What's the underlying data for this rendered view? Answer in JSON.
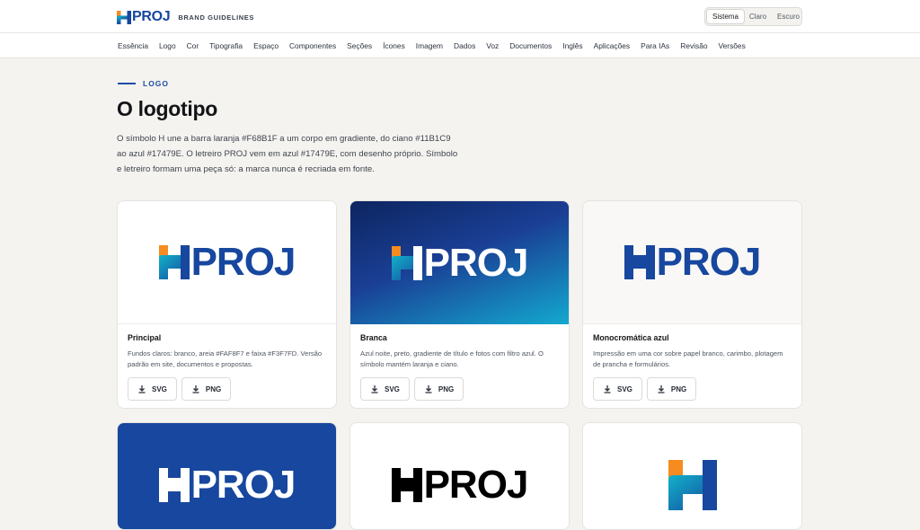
{
  "header": {
    "brand_wordmark": "PROJ",
    "brand_caption": "BRAND GUIDELINES",
    "theme_options": [
      "Sistema",
      "Claro",
      "Escuro"
    ],
    "theme_selected": "Sistema"
  },
  "nav": {
    "items": [
      "Essência",
      "Logo",
      "Cor",
      "Tipografia",
      "Espaço",
      "Componentes",
      "Seções",
      "Ícones",
      "Imagem",
      "Dados",
      "Voz",
      "Documentos",
      "Inglês",
      "Aplicações",
      "Para IAs",
      "Revisão",
      "Versões"
    ]
  },
  "section": {
    "eyebrow": "LOGO",
    "title": "O logotipo",
    "lead": "O símbolo H une a barra laranja #F68B1F a um corpo em gradiente, do ciano #11B1C9 ao azul #17479E. O letreiro PROJ vem em azul #17479E, com desenho próprio. Símbolo e letreiro formam uma peça só: a marca nunca é recriada em fonte."
  },
  "colors": {
    "orange": "#F68B1F",
    "cyan": "#11B1C9",
    "blue": "#17479E",
    "sand": "#FAF8F7",
    "band": "#F3F7FD"
  },
  "cards": [
    {
      "title": "Principal",
      "description": "Fundos claros: branco, areia #FAF8F7 e faixa #F3F7FD. Versão padrão em site, documentos e propostas.",
      "buttons": [
        "SVG",
        "PNG"
      ],
      "wordmark": "PROJ",
      "variant": "color-on-light"
    },
    {
      "title": "Branca",
      "description": "Azul noite, preto, gradiente de título e fotos com filtro azul. O símbolo mantém laranja e ciano.",
      "buttons": [
        "SVG",
        "PNG"
      ],
      "wordmark": "PROJ",
      "variant": "white-on-gradient"
    },
    {
      "title": "Monocromática azul",
      "description": "Impressão em uma cor sobre papel branco, carimbo, plotagem de prancha e formulários.",
      "buttons": [
        "SVG",
        "PNG"
      ],
      "wordmark": "PROJ",
      "variant": "blue-mono"
    },
    {
      "wordmark": "PROJ",
      "variant": "white-mono-on-blue"
    },
    {
      "wordmark": "PROJ",
      "variant": "black-mono"
    },
    {
      "wordmark": "",
      "variant": "symbol-only"
    }
  ],
  "icons": {
    "download": "download-icon"
  }
}
